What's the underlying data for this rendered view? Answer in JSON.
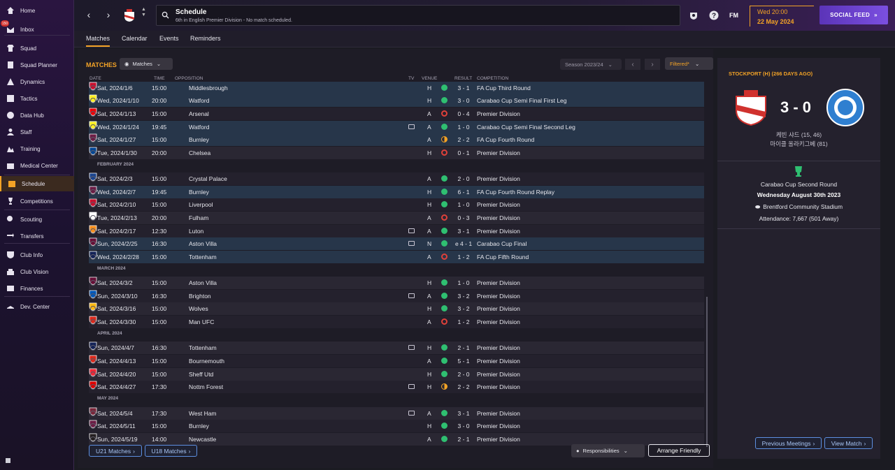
{
  "sidebar": {
    "inbox_badge": "150",
    "items": [
      {
        "label": "Home",
        "icon": "home-icon"
      },
      {
        "label": "Inbox",
        "icon": "inbox-icon"
      },
      {
        "label": "Squad",
        "icon": "shirt-icon"
      },
      {
        "label": "Squad Planner",
        "icon": "planner-icon"
      },
      {
        "label": "Dynamics",
        "icon": "dynamics-icon"
      },
      {
        "label": "Tactics",
        "icon": "tactics-icon"
      },
      {
        "label": "Data Hub",
        "icon": "data-hub-icon"
      },
      {
        "label": "Staff",
        "icon": "staff-icon"
      },
      {
        "label": "Training",
        "icon": "training-icon"
      },
      {
        "label": "Medical Center",
        "icon": "medical-icon"
      },
      {
        "label": "Schedule",
        "icon": "calendar-icon"
      },
      {
        "label": "Competitions",
        "icon": "trophy-icon"
      },
      {
        "label": "Scouting",
        "icon": "scouting-icon"
      },
      {
        "label": "Transfers",
        "icon": "transfers-icon"
      },
      {
        "label": "Club Info",
        "icon": "shield-icon"
      },
      {
        "label": "Club Vision",
        "icon": "vision-icon"
      },
      {
        "label": "Finances",
        "icon": "finances-icon"
      },
      {
        "label": "Dev. Center",
        "icon": "dev-center-icon"
      }
    ]
  },
  "header": {
    "title": "Schedule",
    "subtitle": "6th in English Premier Division - No match scheduled.",
    "fm_logo": "FM",
    "time": "Wed 20:00",
    "date": "22 May 2024",
    "social_feed": "SOCIAL FEED"
  },
  "tabs": [
    "Matches",
    "Calendar",
    "Events",
    "Reminders"
  ],
  "main": {
    "title": "MATCHES",
    "matches_dropdown": "Matches",
    "season": "Season 2023/24",
    "filter": "Filtered*",
    "columns": {
      "date": "DATE",
      "time": "TIME",
      "opposition": "OPPOSITION",
      "tv": "TV",
      "venue": "VENUE",
      "result": "RESULT",
      "competition": "COMPETITION"
    },
    "months": [
      "FEBRUARY 2024",
      "MARCH 2024",
      "APRIL 2024",
      "MAY 2024"
    ],
    "rows": [
      {
        "date": "Sat, 2024/1/6",
        "time": "15:00",
        "opp": "Middlesbrough",
        "venue": "H",
        "result": "3 - 1",
        "comp": "FA Cup Third Round",
        "outcome": "win",
        "tv": false,
        "hl": true
      },
      {
        "date": "Wed, 2024/1/10",
        "time": "20:00",
        "opp": "Watford",
        "venue": "H",
        "result": "3 - 0",
        "comp": "Carabao Cup Semi Final First Leg",
        "outcome": "win",
        "tv": false,
        "hl": true
      },
      {
        "date": "Sat, 2024/1/13",
        "time": "15:00",
        "opp": "Arsenal",
        "venue": "A",
        "result": "0 - 4",
        "comp": "Premier Division",
        "outcome": "loss",
        "tv": false,
        "hl": false
      },
      {
        "date": "Wed, 2024/1/24",
        "time": "19:45",
        "opp": "Watford",
        "venue": "A",
        "result": "1 - 0",
        "comp": "Carabao Cup Semi Final Second Leg",
        "outcome": "win",
        "tv": true,
        "hl": true
      },
      {
        "date": "Sat, 2024/1/27",
        "time": "15:00",
        "opp": "Burnley",
        "venue": "A",
        "result": "2 - 2",
        "comp": "FA Cup Fourth Round",
        "outcome": "draw",
        "tv": false,
        "hl": true
      },
      {
        "date": "Tue, 2024/1/30",
        "time": "20:00",
        "opp": "Chelsea",
        "venue": "H",
        "result": "0 - 1",
        "comp": "Premier Division",
        "outcome": "loss",
        "tv": false,
        "hl": false
      },
      {
        "date": "Sat, 2024/2/3",
        "time": "15:00",
        "opp": "Crystal Palace",
        "venue": "A",
        "result": "2 - 0",
        "comp": "Premier Division",
        "outcome": "win",
        "tv": false,
        "hl": false
      },
      {
        "date": "Wed, 2024/2/7",
        "time": "19:45",
        "opp": "Burnley",
        "venue": "H",
        "result": "6 - 1",
        "comp": "FA Cup Fourth Round Replay",
        "outcome": "win",
        "tv": false,
        "hl": true
      },
      {
        "date": "Sat, 2024/2/10",
        "time": "15:00",
        "opp": "Liverpool",
        "venue": "H",
        "result": "1 - 0",
        "comp": "Premier Division",
        "outcome": "win",
        "tv": false,
        "hl": false
      },
      {
        "date": "Tue, 2024/2/13",
        "time": "20:00",
        "opp": "Fulham",
        "venue": "A",
        "result": "0 - 3",
        "comp": "Premier Division",
        "outcome": "loss",
        "tv": false,
        "hl": false
      },
      {
        "date": "Sat, 2024/2/17",
        "time": "12:30",
        "opp": "Luton",
        "venue": "A",
        "result": "3 - 1",
        "comp": "Premier Division",
        "outcome": "win",
        "tv": true,
        "hl": false
      },
      {
        "date": "Sun, 2024/2/25",
        "time": "16:30",
        "opp": "Aston Villa",
        "venue": "N",
        "result": "e 4 - 1",
        "comp": "Carabao Cup Final",
        "outcome": "win",
        "tv": true,
        "hl": true
      },
      {
        "date": "Wed, 2024/2/28",
        "time": "15:00",
        "opp": "Tottenham",
        "venue": "A",
        "result": "1 - 2",
        "comp": "FA Cup Fifth Round",
        "outcome": "loss",
        "tv": false,
        "hl": true
      },
      {
        "date": "Sat, 2024/3/2",
        "time": "15:00",
        "opp": "Aston Villa",
        "venue": "H",
        "result": "1 - 0",
        "comp": "Premier Division",
        "outcome": "win",
        "tv": false,
        "hl": false
      },
      {
        "date": "Sun, 2024/3/10",
        "time": "16:30",
        "opp": "Brighton",
        "venue": "A",
        "result": "3 - 2",
        "comp": "Premier Division",
        "outcome": "win",
        "tv": true,
        "hl": false
      },
      {
        "date": "Sat, 2024/3/16",
        "time": "15:00",
        "opp": "Wolves",
        "venue": "H",
        "result": "3 - 2",
        "comp": "Premier Division",
        "outcome": "win",
        "tv": false,
        "hl": false
      },
      {
        "date": "Sat, 2024/3/30",
        "time": "15:00",
        "opp": "Man UFC",
        "venue": "A",
        "result": "1 - 2",
        "comp": "Premier Division",
        "outcome": "loss",
        "tv": false,
        "hl": false
      },
      {
        "date": "Sun, 2024/4/7",
        "time": "16:30",
        "opp": "Tottenham",
        "venue": "H",
        "result": "2 - 1",
        "comp": "Premier Division",
        "outcome": "win",
        "tv": true,
        "hl": false
      },
      {
        "date": "Sat, 2024/4/13",
        "time": "15:00",
        "opp": "Bournemouth",
        "venue": "A",
        "result": "5 - 1",
        "comp": "Premier Division",
        "outcome": "win",
        "tv": false,
        "hl": false
      },
      {
        "date": "Sat, 2024/4/20",
        "time": "15:00",
        "opp": "Sheff Utd",
        "venue": "H",
        "result": "2 - 0",
        "comp": "Premier Division",
        "outcome": "win",
        "tv": false,
        "hl": false
      },
      {
        "date": "Sat, 2024/4/27",
        "time": "17:30",
        "opp": "Nottm Forest",
        "venue": "H",
        "result": "2 - 2",
        "comp": "Premier Division",
        "outcome": "draw",
        "tv": true,
        "hl": false
      },
      {
        "date": "Sat, 2024/5/4",
        "time": "17:30",
        "opp": "West Ham",
        "venue": "A",
        "result": "3 - 1",
        "comp": "Premier Division",
        "outcome": "win",
        "tv": true,
        "hl": false
      },
      {
        "date": "Sat, 2024/5/11",
        "time": "15:00",
        "opp": "Burnley",
        "venue": "H",
        "result": "3 - 0",
        "comp": "Premier Division",
        "outcome": "win",
        "tv": false,
        "hl": false
      },
      {
        "date": "Sun, 2024/5/19",
        "time": "14:00",
        "opp": "Newcastle",
        "venue": "A",
        "result": "2 - 1",
        "comp": "Premier Division",
        "outcome": "win",
        "tv": false,
        "hl": false
      }
    ],
    "btn_u21": "U21 Matches",
    "btn_u18": "U18 Matches",
    "btn_responsibilities": "Responsibilities",
    "btn_arrange": "Arrange Friendly"
  },
  "right_panel": {
    "title": "STOCKPORT (H) (266 DAYS AGO)",
    "score": "3 - 0",
    "scorer1": "케빈 샤드 (15, 46)",
    "scorer2": "마이클 올라키그베 (81)",
    "competition": "Carabao Cup Second Round",
    "date": "Wednesday August 30th 2023",
    "stadium": "Brentford Community Stadium",
    "attendance": "Attendance: 7,667 (501 Away)",
    "btn_prev": "Previous Meetings",
    "btn_view": "View Match"
  },
  "colors": {
    "accent": "#f3a326",
    "win": "#2fbf71",
    "loss": "#e0413a",
    "social": "#6a40d0",
    "link": "#5d8fe0"
  }
}
